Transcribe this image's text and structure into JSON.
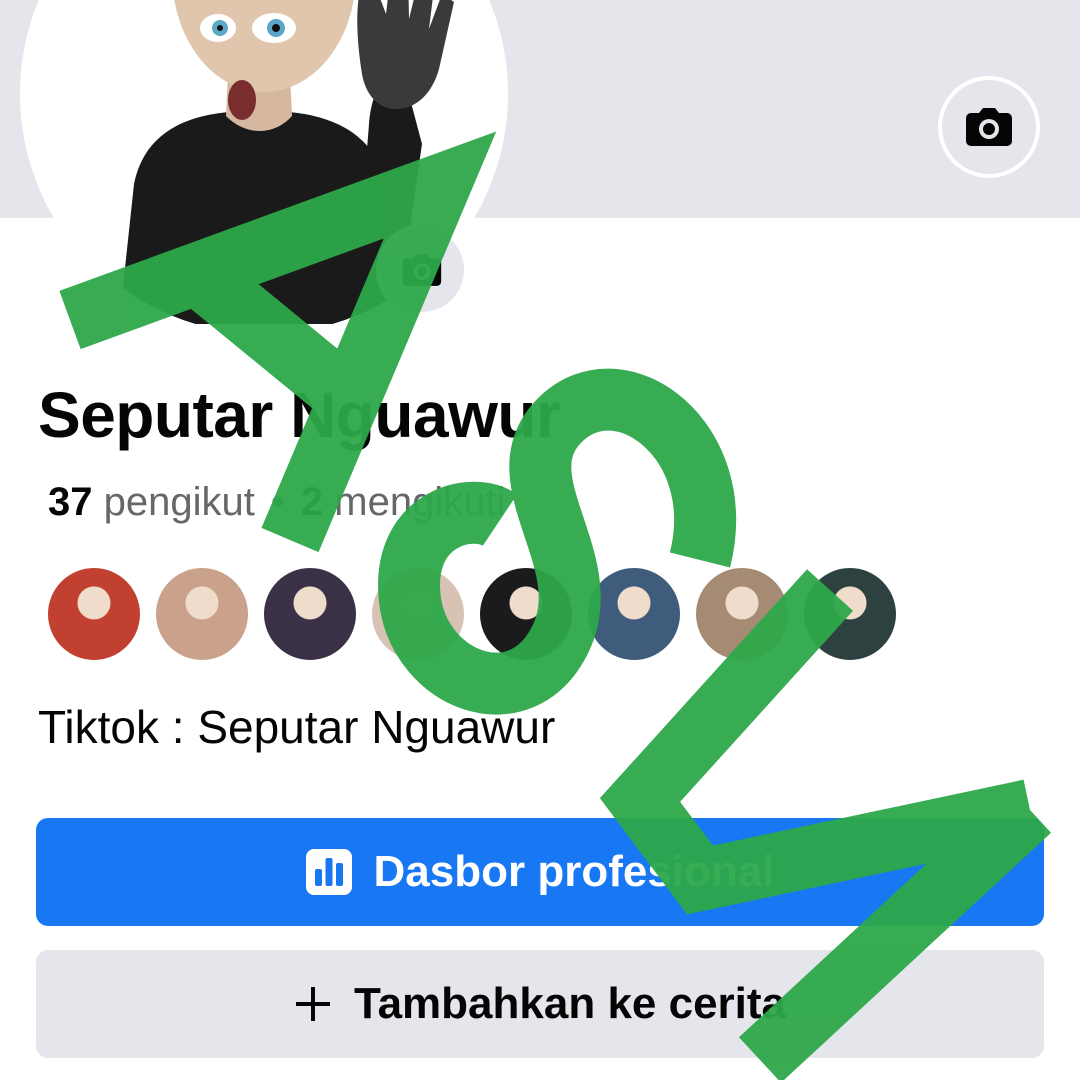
{
  "profile": {
    "name": "Seputar Nguawur",
    "followers_count": "37",
    "followers_label": "pengikut",
    "separator": "•",
    "following_count": "2",
    "following_label": "mengikuti",
    "bio": "Tiktok : Seputar Nguawur"
  },
  "friends": [
    {
      "name": "friend-avatar-1",
      "color": "#c2402f"
    },
    {
      "name": "friend-avatar-2",
      "color": "#caa18a"
    },
    {
      "name": "friend-avatar-3",
      "color": "#3a3146"
    },
    {
      "name": "friend-avatar-4",
      "color": "#d8c2b4"
    },
    {
      "name": "friend-avatar-5",
      "color": "#1b1b1d"
    },
    {
      "name": "friend-avatar-6",
      "color": "#3f5c7c"
    },
    {
      "name": "friend-avatar-7",
      "color": "#a58b74"
    },
    {
      "name": "friend-avatar-8",
      "color": "#2c4140"
    }
  ],
  "actions": {
    "dashboard_label": "Dasbor profesional",
    "dashboard_icon": "bar-chart-icon",
    "add_story_label": "Tambahkan ke cerita",
    "add_story_icon": "plus-icon"
  },
  "overlay": {
    "watermark_text": "ASLI",
    "watermark_color": "#2ea84a"
  },
  "colors": {
    "primary": "#1877f2",
    "secondary_bg": "#e4e6eb",
    "muted_text": "#65676b"
  }
}
